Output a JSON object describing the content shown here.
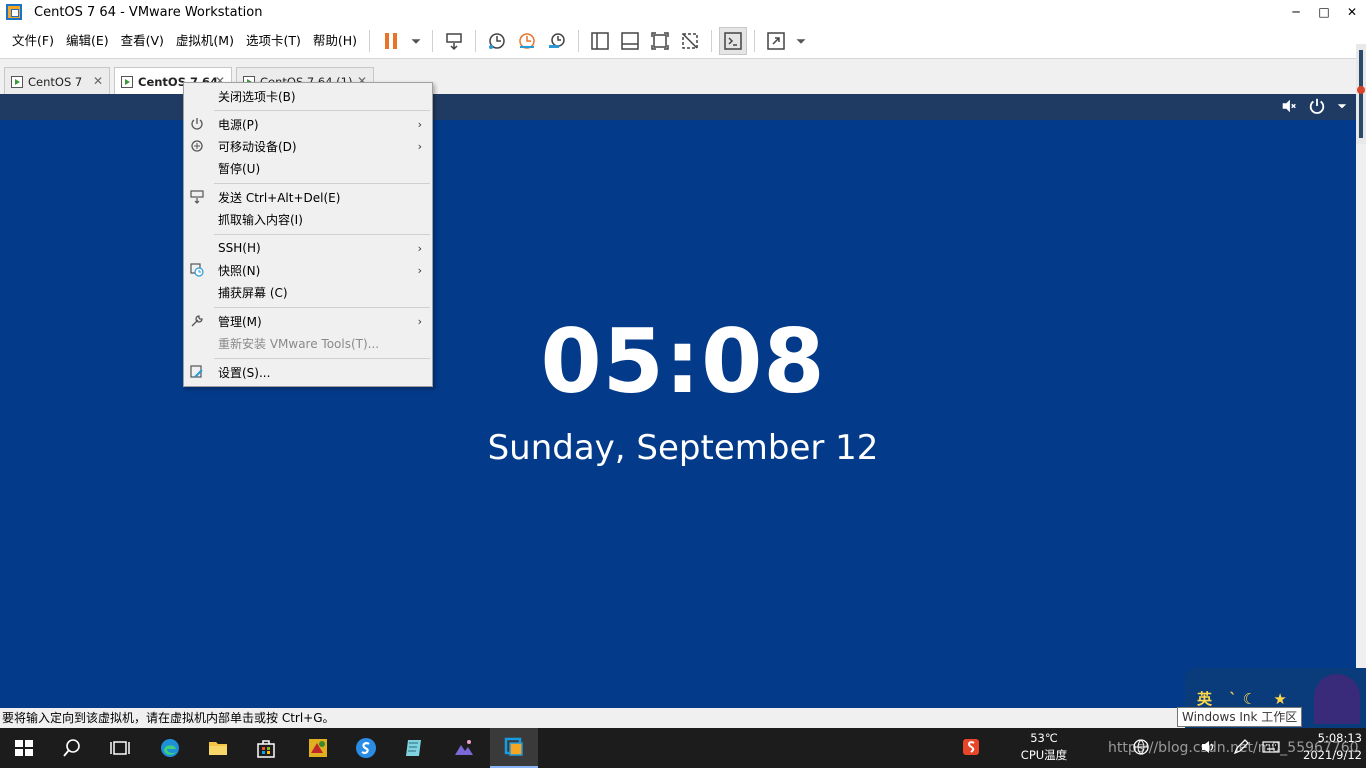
{
  "window": {
    "title": "CentOS 7 64 - VMware Workstation",
    "minimize_glyph": "─",
    "maximize_glyph": "□",
    "close_glyph": "✕"
  },
  "menubar": {
    "items": [
      {
        "label": "文件(F)"
      },
      {
        "label": "编辑(E)"
      },
      {
        "label": "查看(V)"
      },
      {
        "label": "虚拟机(M)"
      },
      {
        "label": "选项卡(T)"
      },
      {
        "label": "帮助(H)"
      }
    ]
  },
  "tabs": [
    {
      "label": "CentOS 7",
      "close": "✕",
      "active": false
    },
    {
      "label": "CentOS 7 64",
      "close": "✕",
      "active": true
    },
    {
      "label": "CentOS 7 64 (1)",
      "close": "✕",
      "active": false
    }
  ],
  "vm": {
    "clock": "05:08",
    "date": "Sunday, September 12",
    "background_color": "#033a8a"
  },
  "context_menu": {
    "items": [
      {
        "label": "关闭选项卡(B)"
      },
      {
        "label": "电源(P)",
        "icon": "power-icon",
        "submenu": true
      },
      {
        "label": "可移动设备(D)",
        "icon": "removable-device-icon",
        "submenu": true
      },
      {
        "label": "暂停(U)"
      },
      {
        "label": "发送 Ctrl+Alt+Del(E)",
        "icon": "send-keys-icon"
      },
      {
        "label": "抓取输入内容(I)"
      },
      {
        "label": "SSH(H)",
        "submenu": true
      },
      {
        "label": "快照(N)",
        "icon": "snapshot-icon",
        "submenu": true
      },
      {
        "label": "捕获屏幕 (C)"
      },
      {
        "label": "管理(M)",
        "icon": "wrench-icon",
        "submenu": true
      },
      {
        "label": "重新安装 VMware Tools(T)...",
        "disabled": true
      },
      {
        "label": "设置(S)...",
        "icon": "settings-icon"
      }
    ],
    "arrow": "›"
  },
  "status": {
    "message": "要将输入定向到该虚拟机，请在虚拟机内部单击或按 Ctrl+G。"
  },
  "ink": {
    "glyphs": "英 ˋ☾ ★",
    "tooltip": "Windows Ink 工作区"
  },
  "tray": {
    "temp_value": "53℃",
    "temp_label": "CPU温度",
    "time": "5:08:13",
    "date": "2021/9/12",
    "watermark": "https://blog.csdn.net/m0_55967760"
  },
  "colors": {
    "accent": "#1a73c9",
    "pause": "#e8742a",
    "taskbar": "#1c1c1c"
  }
}
